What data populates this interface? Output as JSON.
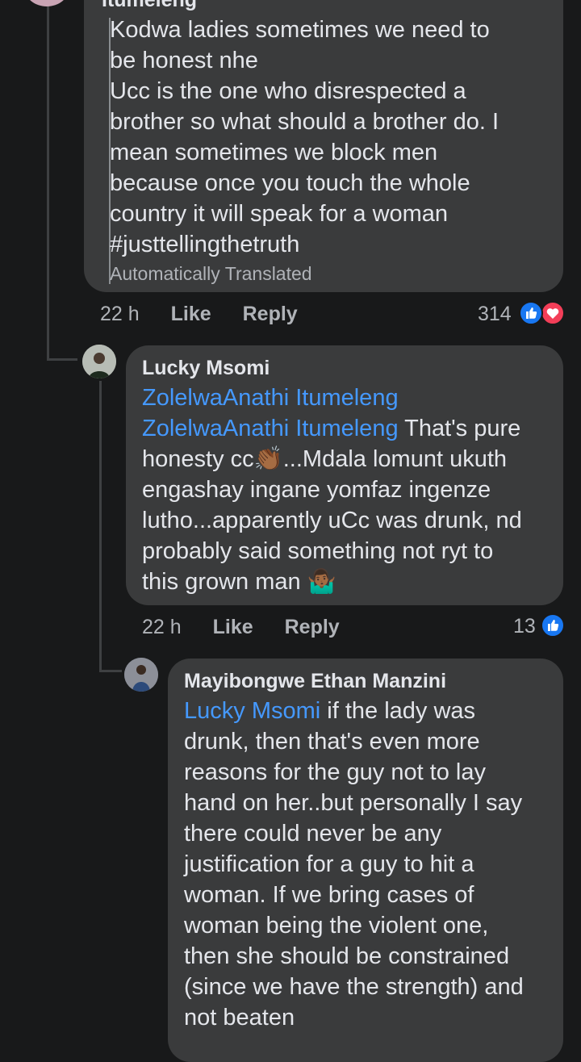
{
  "comment1": {
    "author_fragment": "Itumeleng",
    "lines": [
      "Kodwa ladies sometimes  we need  to",
      "be honest nhe",
      "Ucc is the one who disrespected a",
      "brother so what should a brother do. I",
      "mean sometimes we block men",
      "because once you touch the whole",
      "country it will speak for a woman",
      "#justtellingthetruth"
    ],
    "translated_label": "Automatically Translated",
    "time": "22 h",
    "like_label": "Like",
    "reply_label": "Reply",
    "reaction_count": "314",
    "reactions": [
      "like-icon",
      "love-icon"
    ]
  },
  "comment2": {
    "author": "Lucky Msomi",
    "mention1": "ZolelwaAnathi Itumeleng",
    "mention2": "ZolelwaAnathi Itumeleng",
    "line2_rest": " That's pure",
    "line3_a": "honesty cc",
    "emoji1": "👏🏾",
    "line3_b": "...Mdala lomunt ukuth",
    "lines": [
      "engashay ingane yomfaz ingenze",
      "lutho...apparently uCc was drunk,  nd",
      "probably said something not ryt to"
    ],
    "last_line": "this grown man ",
    "emoji2": "🤷🏾‍♂️",
    "time": "22 h",
    "like_label": "Like",
    "reply_label": "Reply",
    "reaction_count": "13",
    "reactions": [
      "like-icon"
    ]
  },
  "comment3": {
    "author": "Mayibongwe Ethan Manzini",
    "mention": "Lucky Msomi",
    "line1_rest": " if the lady was",
    "lines": [
      "drunk, then that's even more",
      "reasons for the guy not to lay",
      "hand on her..but personally I say",
      "there could never be any",
      "justification for a guy to hit a",
      "woman. If we bring cases of",
      "woman being the violent one,",
      "then she should be constrained",
      "(since we have the strength) and",
      "not beaten"
    ]
  },
  "colors": {
    "background": "#18191a",
    "bubble": "#3a3b3c",
    "mention": "#4599ff",
    "like": "#1877f2",
    "love": "#f33e58"
  }
}
